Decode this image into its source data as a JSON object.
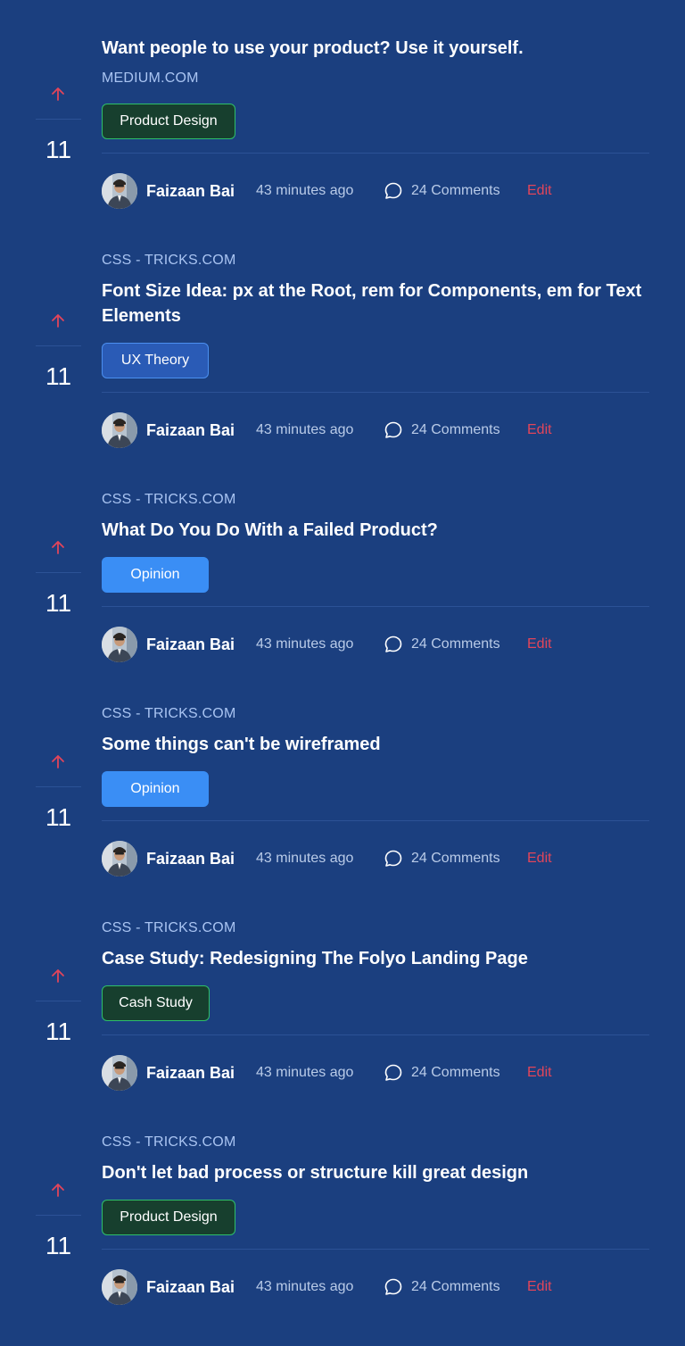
{
  "posts": [
    {
      "source": "MEDIUM.COM",
      "title": "Want people to use your product? Use it yourself.",
      "tag": "Product Design",
      "votes": "11",
      "author": "Faizaan Bai",
      "time": "43 minutes ago",
      "comments": "24 Comments",
      "edit": "Edit"
    },
    {
      "source": "CSS - TRICKS.COM",
      "title": "Font Size Idea: px at the Root, rem for Components, em for Text Elements",
      "tag": "UX Theory",
      "votes": "11",
      "author": "Faizaan Bai",
      "time": "43 minutes ago",
      "comments": "24 Comments",
      "edit": "Edit"
    },
    {
      "source": "CSS - TRICKS.COM",
      "title": "What Do You Do With a Failed Product?",
      "tag": "Opinion",
      "votes": "11",
      "author": "Faizaan Bai",
      "time": "43 minutes ago",
      "comments": "24 Comments",
      "edit": "Edit"
    },
    {
      "source": "CSS - TRICKS.COM",
      "title": "Some things can't be wireframed",
      "tag": "Opinion",
      "votes": "11",
      "author": "Faizaan Bai",
      "time": "43 minutes ago",
      "comments": "24 Comments",
      "edit": "Edit"
    },
    {
      "source": "CSS - TRICKS.COM",
      "title": "Case Study: Redesigning The Folyo Landing Page",
      "tag": "Cash Study",
      "votes": "11",
      "author": "Faizaan Bai",
      "time": "43 minutes ago",
      "comments": "24 Comments",
      "edit": "Edit"
    },
    {
      "source": "CSS - TRICKS.COM",
      "title": "Don't let bad process or structure kill great design",
      "tag": "Product Design",
      "votes": "11",
      "author": "Faizaan Bai",
      "time": "43 minutes ago",
      "comments": "24 Comments",
      "edit": "Edit"
    }
  ],
  "colors": {
    "background": "#1b3f7f",
    "upvote": "#e2455a",
    "edit": "#e2455a",
    "tag_green": "#173f2e",
    "tag_blue": "#2a5bb6",
    "tag_light": "#3a8ef5"
  },
  "icons": {
    "upvote": "arrow-up-icon",
    "comment": "speech-bubble-icon"
  }
}
